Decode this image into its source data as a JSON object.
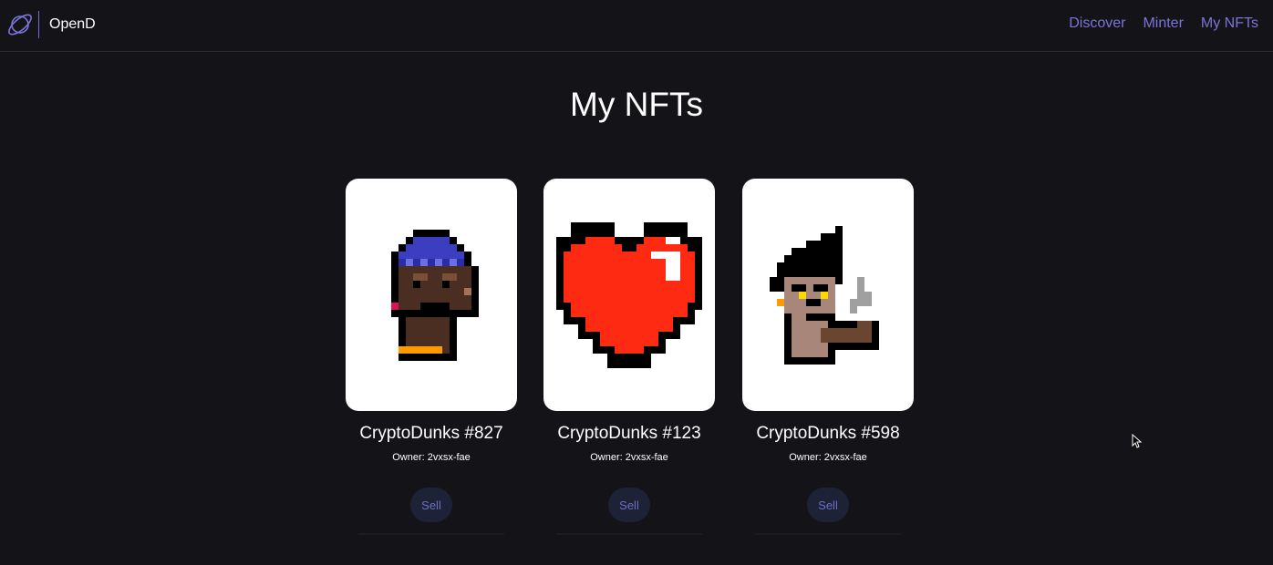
{
  "app": {
    "brand_name": "OpenD",
    "logo_icon": "planet-logo-icon",
    "accent_color": "#7a74d8"
  },
  "nav": {
    "items": [
      {
        "label": "Discover"
      },
      {
        "label": "Minter"
      },
      {
        "label": "My NFTs"
      }
    ]
  },
  "page": {
    "title": "My NFTs"
  },
  "cards": [
    {
      "title": "CryptoDunks #827",
      "owner": "Owner: 2vxsx-fae",
      "sell_label": "Sell",
      "image_icon": "pixel-punk-beanie-image"
    },
    {
      "title": "CryptoDunks #123",
      "owner": "Owner: 2vxsx-fae",
      "sell_label": "Sell",
      "image_icon": "pixel-heart-image"
    },
    {
      "title": "CryptoDunks #598",
      "owner": "Owner: 2vxsx-fae",
      "sell_label": "Sell",
      "image_icon": "pixel-punk-pipe-image"
    }
  ]
}
